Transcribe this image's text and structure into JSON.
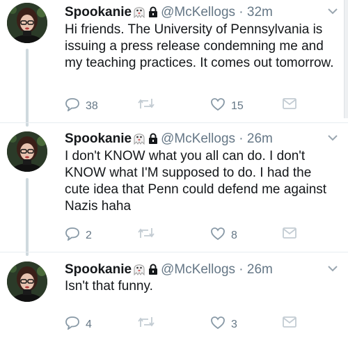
{
  "tweets": [
    {
      "name": "Spookanie",
      "handle": "@McKellogs",
      "sep": "·",
      "time": "32m",
      "text": "Hi friends. The University of Pennsylvania is issuing a press release condemning me and my teaching practices. It comes out tomorrow.",
      "replies": "38",
      "likes": "15"
    },
    {
      "name": "Spookanie",
      "handle": "@McKellogs",
      "sep": "·",
      "time": "26m",
      "text": "I don't KNOW what you all can do. I don't KNOW what I'M supposed to do. I had the cute idea that Penn could defend me against Nazis haha",
      "replies": "2",
      "likes": "8"
    },
    {
      "name": "Spookanie",
      "handle": "@McKellogs",
      "sep": "·",
      "time": "26m",
      "text": "Isn't that funny.",
      "replies": "4",
      "likes": "3"
    }
  ],
  "icons": {
    "name_emoji": "ghost-icon",
    "protected": "lock-icon",
    "reply": "reply-icon",
    "retweet": "retweet-icon",
    "like": "heart-icon",
    "dm": "envelope-icon",
    "menu": "chevron-down-icon"
  },
  "colors": {
    "text": "#14171a",
    "muted": "#657786",
    "thread_line": "#cfd9de",
    "icon_gray": "#8899a6"
  }
}
